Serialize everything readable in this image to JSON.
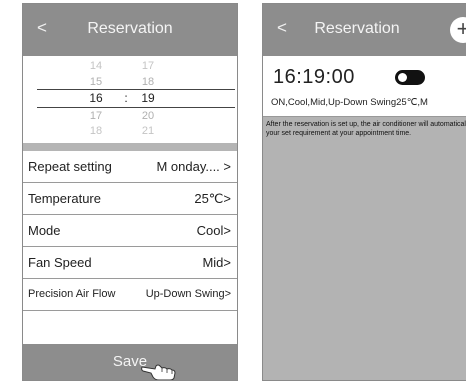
{
  "left": {
    "header": {
      "back": "<",
      "title": "Reservation"
    },
    "picker": {
      "rows": [
        {
          "hour": "14",
          "minute": "17"
        },
        {
          "hour": "15",
          "minute": "18"
        },
        {
          "hour": "16",
          "minute": "19"
        },
        {
          "hour": "17",
          "minute": "20"
        },
        {
          "hour": "18",
          "minute": "21"
        }
      ],
      "separator": ":"
    },
    "settings": [
      {
        "label": "Repeat setting",
        "value": "M onday.... >"
      },
      {
        "label": "Temperature",
        "value": "25℃>"
      },
      {
        "label": "Mode",
        "value": "Cool>"
      },
      {
        "label": "Fan Speed",
        "value": "Mid>"
      },
      {
        "label": "Precision Air Flow",
        "value": "Up-Down Swing>"
      }
    ],
    "save_label": "Save"
  },
  "right": {
    "header": {
      "back": "<",
      "title": "Reservation",
      "add": "+"
    },
    "reservation": {
      "time": "16:19:00",
      "enabled": true,
      "summary": "ON,Cool,Mid,Up-Down Swing25℃,M"
    },
    "note": "After the reservation is set up, the air conditioner will automatically reach your set requirement at your appointment time."
  }
}
